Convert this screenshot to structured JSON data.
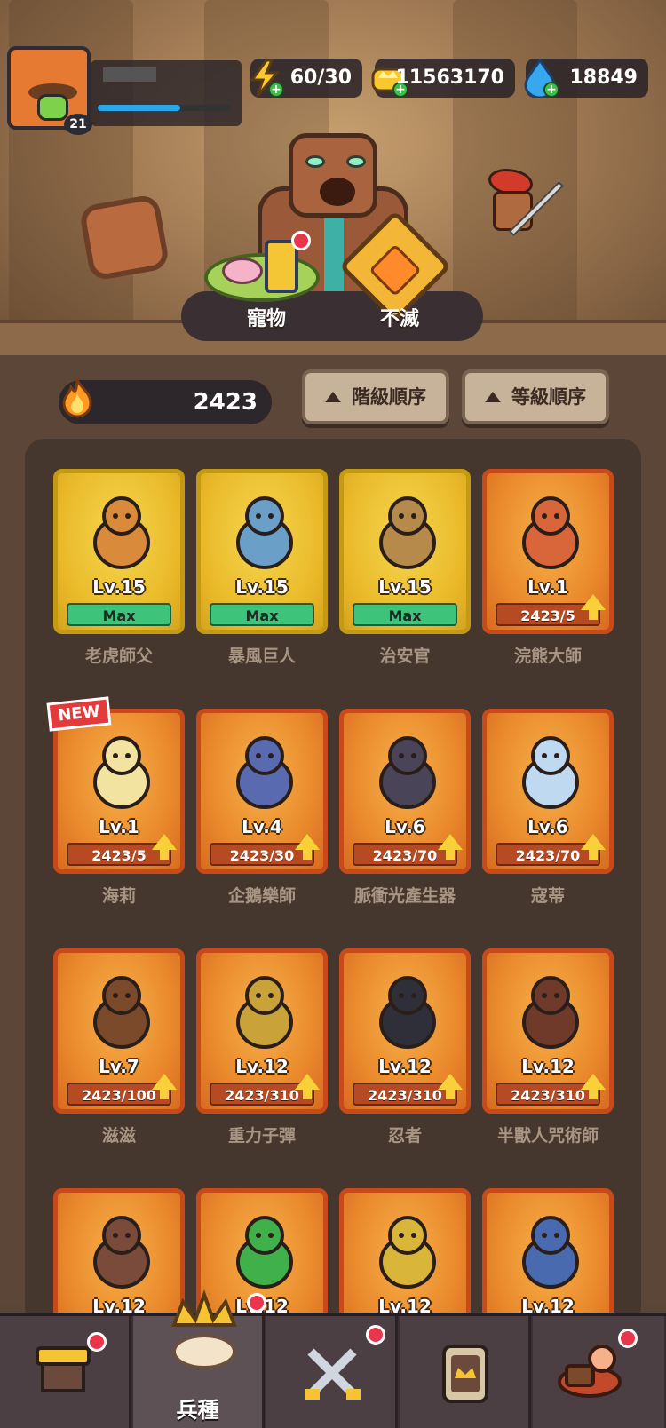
{
  "player": {
    "level": "21",
    "xp_fraction": 0.62
  },
  "resources": {
    "energy": "60/30",
    "gold": "11563170",
    "gems": "18849"
  },
  "modes": {
    "pet": "寵物",
    "immortal": "不滅"
  },
  "power": "2423",
  "sort": {
    "rank": "階級順序",
    "level": "等級順序"
  },
  "units": [
    {
      "name": "老虎師父",
      "level": "Lv.15",
      "status": "Max",
      "tier": "gold"
    },
    {
      "name": "暴風巨人",
      "level": "Lv.15",
      "status": "Max",
      "tier": "gold"
    },
    {
      "name": "治安官",
      "level": "Lv.15",
      "status": "Max",
      "tier": "gold"
    },
    {
      "name": "浣熊大師",
      "level": "Lv.1",
      "status": "2423/5",
      "tier": "orange"
    },
    {
      "name": "海莉",
      "level": "Lv.1",
      "status": "2423/5",
      "tier": "orange",
      "badge": "NEW"
    },
    {
      "name": "企鵝樂師",
      "level": "Lv.4",
      "status": "2423/30",
      "tier": "orange"
    },
    {
      "name": "脈衝光產生器",
      "level": "Lv.6",
      "status": "2423/70",
      "tier": "orange"
    },
    {
      "name": "寇蒂",
      "level": "Lv.6",
      "status": "2423/70",
      "tier": "orange"
    },
    {
      "name": "滋滋",
      "level": "Lv.7",
      "status": "2423/100",
      "tier": "orange"
    },
    {
      "name": "重力子彈",
      "level": "Lv.12",
      "status": "2423/310",
      "tier": "orange"
    },
    {
      "name": "忍者",
      "level": "Lv.12",
      "status": "2423/310",
      "tier": "orange"
    },
    {
      "name": "半獸人咒術師",
      "level": "Lv.12",
      "status": "2423/310",
      "tier": "orange"
    },
    {
      "name": "",
      "level": "Lv.12",
      "status": "",
      "tier": "orange"
    },
    {
      "name": "",
      "level": "Lv.12",
      "status": "",
      "tier": "orange"
    },
    {
      "name": "",
      "level": "Lv.12",
      "status": "",
      "tier": "orange"
    },
    {
      "name": "",
      "level": "Lv.12",
      "status": "",
      "tier": "orange"
    }
  ],
  "nav": {
    "troops_label": "兵種"
  },
  "colors": {
    "accent_gold": "#f6d64d",
    "accent_orange": "#ea8a2c",
    "max_green": "#3ec47a"
  }
}
